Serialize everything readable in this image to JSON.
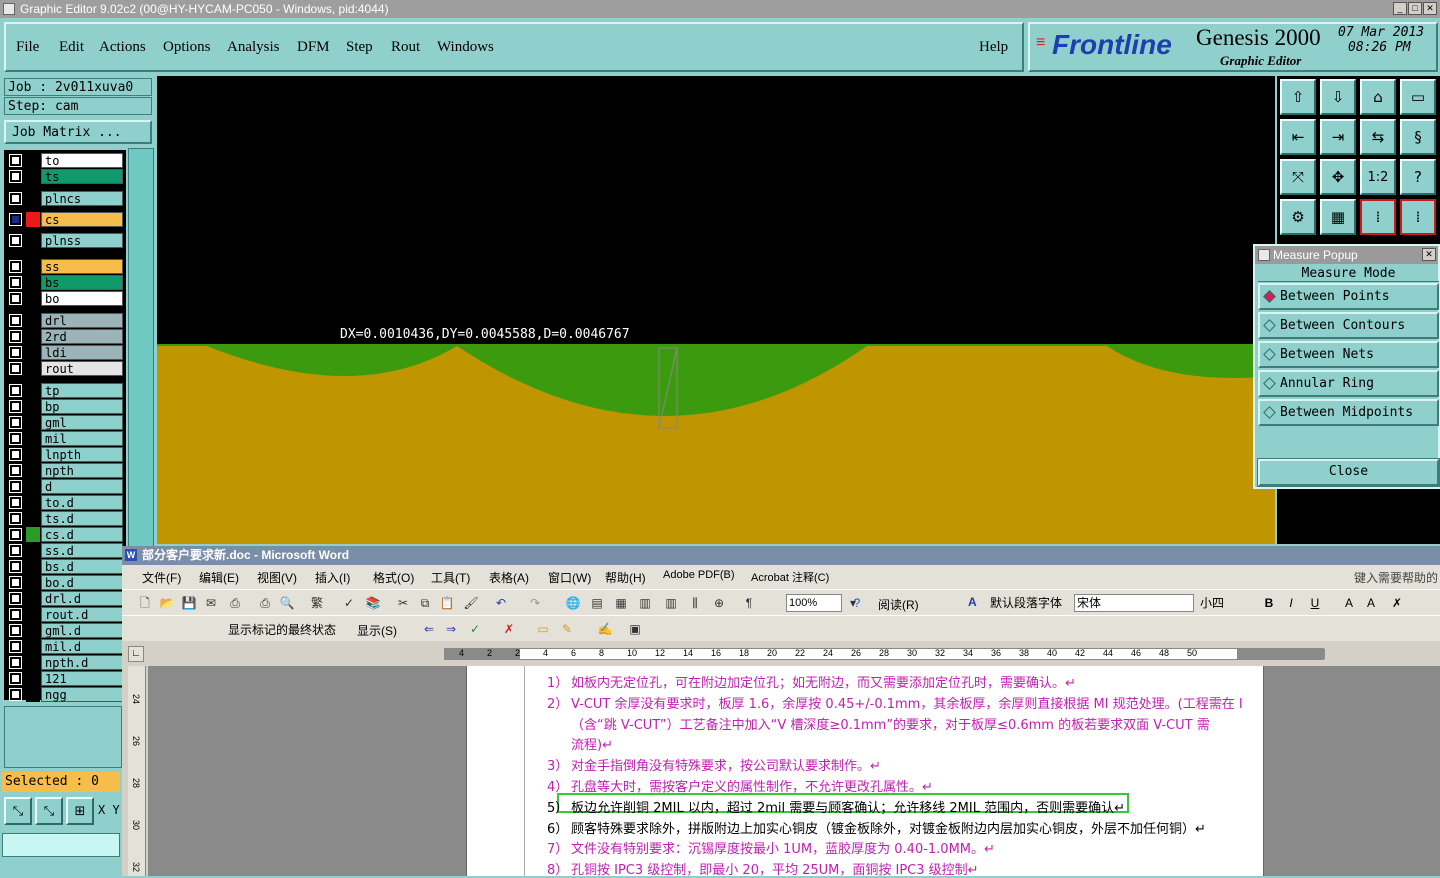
{
  "window_title": "Graphic Editor 9.02c2 (00@HY-HYCAM-PC050 - Windows, pid:4044)",
  "menu": [
    "File",
    "Edit",
    "Actions",
    "Options",
    "Analysis",
    "DFM",
    "Step",
    "Rout",
    "Windows"
  ],
  "help_label": "Help",
  "logo": {
    "brand": "Frontline",
    "product": "Genesis 2000",
    "subtitle": "Graphic Editor",
    "date": "07 Mar 2013",
    "time": "08:26 PM"
  },
  "job_label": "Job : 2v011xuva0",
  "step_label": "Step: cam",
  "job_matrix_label": "Job Matrix ...",
  "layers": [
    {
      "name": "to",
      "color": "#ffffff",
      "checked": false,
      "swatch": "#000000"
    },
    {
      "name": "ts",
      "color": "#10996b",
      "checked": false,
      "swatch": "#000000"
    },
    {
      "name": "plncs",
      "color": "#8fd0cc",
      "checked": false,
      "swatch": "#000000"
    },
    {
      "name": "cs",
      "color": "#f6bd4a",
      "checked": true,
      "swatch": "#e81a1a"
    },
    {
      "name": "plnss",
      "color": "#8fd0cc",
      "checked": false,
      "swatch": "#000000"
    },
    {
      "name": "ss",
      "color": "#f6bd4a",
      "checked": false,
      "swatch": "#000000"
    },
    {
      "name": "bs",
      "color": "#10996b",
      "checked": false,
      "swatch": "#000000"
    },
    {
      "name": "bo",
      "color": "#ffffff",
      "checked": false,
      "swatch": "#000000"
    },
    {
      "name": "drl",
      "color": "#9ab4b8",
      "checked": false,
      "swatch": "#000000"
    },
    {
      "name": "2rd",
      "color": "#9ab4b8",
      "checked": false,
      "swatch": "#000000"
    },
    {
      "name": "ldi",
      "color": "#9ab4b8",
      "checked": false,
      "swatch": "#000000"
    },
    {
      "name": "rout",
      "color": "#e4e4e4",
      "checked": false,
      "swatch": "#000000"
    },
    {
      "name": "tp",
      "color": "#8fd0cc",
      "checked": false,
      "swatch": "#000000"
    },
    {
      "name": "bp",
      "color": "#8fd0cc",
      "checked": false,
      "swatch": "#000000"
    },
    {
      "name": "gml",
      "color": "#8fd0cc",
      "checked": false,
      "swatch": "#000000"
    },
    {
      "name": "mil",
      "color": "#8fd0cc",
      "checked": false,
      "swatch": "#000000"
    },
    {
      "name": "lnpth",
      "color": "#8fd0cc",
      "checked": false,
      "swatch": "#000000"
    },
    {
      "name": "npth",
      "color": "#8fd0cc",
      "checked": false,
      "swatch": "#000000"
    },
    {
      "name": "d",
      "color": "#8fd0cc",
      "checked": false,
      "swatch": "#000000"
    },
    {
      "name": "to.d",
      "color": "#8fd0cc",
      "checked": false,
      "swatch": "#000000"
    },
    {
      "name": "ts.d",
      "color": "#8fd0cc",
      "checked": false,
      "swatch": "#000000"
    },
    {
      "name": "cs.d",
      "color": "#8fd0cc",
      "checked": false,
      "swatch": "#2a9a2a"
    },
    {
      "name": "ss.d",
      "color": "#8fd0cc",
      "checked": false,
      "swatch": "#000000"
    },
    {
      "name": "bs.d",
      "color": "#8fd0cc",
      "checked": false,
      "swatch": "#000000"
    },
    {
      "name": "bo.d",
      "color": "#8fd0cc",
      "checked": false,
      "swatch": "#000000"
    },
    {
      "name": "drl.d",
      "color": "#8fd0cc",
      "checked": false,
      "swatch": "#000000"
    },
    {
      "name": "rout.d",
      "color": "#8fd0cc",
      "checked": false,
      "swatch": "#000000"
    },
    {
      "name": "gml.d",
      "color": "#8fd0cc",
      "checked": false,
      "swatch": "#000000"
    },
    {
      "name": "mil.d",
      "color": "#8fd0cc",
      "checked": false,
      "swatch": "#000000"
    },
    {
      "name": "npth.d",
      "color": "#8fd0cc",
      "checked": false,
      "swatch": "#000000"
    },
    {
      "name": "121",
      "color": "#8fd0cc",
      "checked": false,
      "swatch": "#000000"
    },
    {
      "name": "ngg",
      "color": "#8fd0cc",
      "checked": false,
      "swatch": "#000000"
    }
  ],
  "selected_label": "Selected : 0",
  "xy_label": "X Y",
  "measure_readout": "DX=0.0010436,DY=0.0045588,D=0.0046767",
  "tool_icons": [
    "layer-up-icon",
    "layer-down-icon",
    "home-icon",
    "window-icon",
    "prev-icon",
    "next-icon",
    "swap-icon",
    "s-curve-icon",
    "fit-icon",
    "zoom-icon",
    "one-to-two-icon",
    "help-icon",
    "tools-icon",
    "grid-icon",
    "nets-icon",
    "nets-active-icon"
  ],
  "tool_glyphs": [
    "⇧",
    "⇩",
    "⌂",
    "▭",
    "⇤",
    "⇥",
    "⇆",
    "§",
    "⤧",
    "✥",
    "1:2",
    "?",
    "⚙",
    "▦",
    "⁞",
    "⁞"
  ],
  "measure_popup": {
    "title": "Measure Popup",
    "mode_header": "Measure Mode",
    "options": [
      "Between Points",
      "Between Contours",
      "Between Nets",
      "Annular Ring",
      "Between Midpoints"
    ],
    "selected": "Between Points",
    "close_label": "Close"
  },
  "word": {
    "title": "部分客户要求新.doc - Microsoft Word",
    "menu": [
      "文件(F)",
      "编辑(E)",
      "视图(V)",
      "插入(I)",
      "格式(O)",
      "工具(T)",
      "表格(A)",
      "窗口(W)",
      "帮助(H)",
      "Adobe PDF(B)",
      "Acrobat 注释(C)"
    ],
    "help_box": "键入需要帮助的",
    "zoom": "100%",
    "read_label": "阅读(R)",
    "style": "默认段落字体",
    "font": "宋体",
    "size": "小四",
    "markup_state": "显示标记的最终状态",
    "show_label": "显示(S)",
    "ruler_ticks": [
      "4",
      "2",
      "2",
      "4",
      "6",
      "8",
      "10",
      "12",
      "14",
      "16",
      "18",
      "20",
      "22",
      "24",
      "26",
      "28",
      "30",
      "32",
      "34",
      "36",
      "38",
      "40",
      "42",
      "44",
      "46",
      "48",
      "50"
    ],
    "vruler_ticks": [
      "24",
      "26",
      "28",
      "30",
      "32"
    ],
    "lines": [
      {
        "num": "1）",
        "text": "如板内无定位孔，可在附边加定位孔；如无附边，而又需要添加定位孔时，需要确认。↵",
        "color": "pink"
      },
      {
        "num": "2）",
        "text": "V-CUT 余厚没有要求时，板厚 1.6，余厚按 0.45+/-0.1mm，其余板厚，余厚则直接根据 MI 规范处理。(工程需在 I",
        "color": "pink"
      },
      {
        "num": "",
        "text": "（含“跳 V-CUT”）工艺备注中加入“V 槽深度≥0.1mm”的要求，对于板厚≤0.6mm 的板若要求双面 V-CUT 需",
        "color": "pink"
      },
      {
        "num": "",
        "text": "流程)↵",
        "color": "pink"
      },
      {
        "num": "3）",
        "text": "对金手指倒角没有特殊要求，按公司默认要求制作。↵",
        "color": "pink"
      },
      {
        "num": "4）",
        "text": "孔盘等大时，需按客户定义的属性制作，不允许更改孔属性。↵",
        "color": "pink"
      },
      {
        "num": "5）",
        "text": "板边允许削铜 2MIL 以内，超过 2mil 需要与顾客确认；允许移线 2MIL 范围内，否则需要确认↵",
        "color": "black"
      },
      {
        "num": "6）",
        "text": "顾客特殊要求除外，拼版附边上加实心铜皮（镀金板除外，对镀金板附边内层加实心铜皮，外层不加任何铜）↵",
        "color": "black"
      },
      {
        "num": "7）",
        "text": "文件没有特别要求：沉锡厚度按最小 1UM，蓝胶厚度为 0.40-1.0MM。↵",
        "color": "pink"
      },
      {
        "num": "8）",
        "text": "孔铜按 IPC3 级控制，即最小 20，平均 25UM，面铜按 IPC3 级控制↵",
        "color": "pink"
      }
    ]
  }
}
